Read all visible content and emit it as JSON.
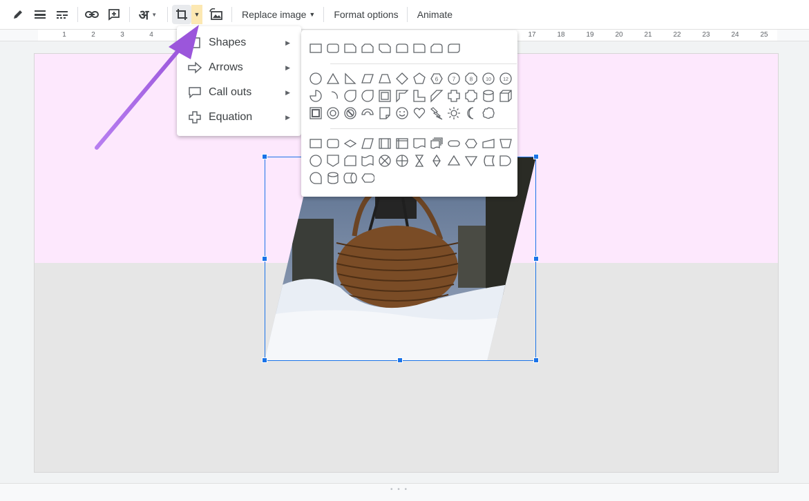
{
  "toolbar": {
    "replace_image_label": "Replace image",
    "format_options_label": "Format options",
    "animate_label": "Animate",
    "input_tool_glyph": "अ"
  },
  "ruler": {
    "numbers": [
      "1",
      "2",
      "3",
      "4",
      "17",
      "18",
      "19",
      "20",
      "21",
      "22",
      "23",
      "24",
      "25"
    ]
  },
  "crop_menu": {
    "items": [
      {
        "label": "Shapes",
        "icon": "square-icon"
      },
      {
        "label": "Arrows",
        "icon": "arrow-right-icon"
      },
      {
        "label": "Call outs",
        "icon": "callout-icon"
      },
      {
        "label": "Equation",
        "icon": "plus-icon"
      }
    ]
  },
  "shape_badges": {
    "six": "6",
    "seven": "7",
    "eight": "8",
    "ten": "10",
    "twelve": "12"
  },
  "colors": {
    "accent": "#1a73e8",
    "highlight": "#fce8b2",
    "slide_top": "#fde8fd",
    "slide_bottom": "#e6e6e6",
    "pointer": "#a55ee3"
  }
}
